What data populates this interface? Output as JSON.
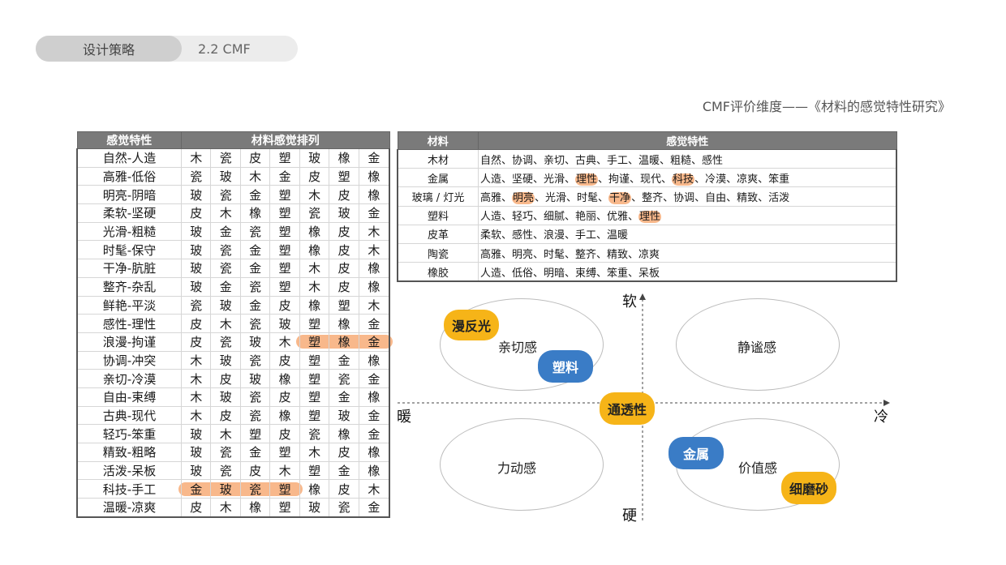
{
  "header": {
    "section": "设计策略",
    "subsection": "2.2 CMF"
  },
  "reference": "CMF评价维度——《材料的感觉特性研究》",
  "table1": {
    "headers": [
      "感觉特性",
      "材料感觉排列"
    ],
    "rows": [
      [
        "自然-人造",
        "木",
        "瓷",
        "皮",
        "塑",
        "玻",
        "橡",
        "金"
      ],
      [
        "高雅-低俗",
        "瓷",
        "玻",
        "木",
        "金",
        "皮",
        "塑",
        "橡"
      ],
      [
        "明亮-阴暗",
        "玻",
        "瓷",
        "金",
        "塑",
        "木",
        "皮",
        "橡"
      ],
      [
        "柔软-坚硬",
        "皮",
        "木",
        "橡",
        "塑",
        "瓷",
        "玻",
        "金"
      ],
      [
        "光滑-粗糙",
        "玻",
        "金",
        "瓷",
        "塑",
        "橡",
        "皮",
        "木"
      ],
      [
        "时髦-保守",
        "玻",
        "瓷",
        "金",
        "塑",
        "橡",
        "皮",
        "木"
      ],
      [
        "干净-肮脏",
        "玻",
        "瓷",
        "金",
        "塑",
        "木",
        "皮",
        "橡"
      ],
      [
        "整齐-杂乱",
        "玻",
        "金",
        "瓷",
        "塑",
        "木",
        "皮",
        "橡"
      ],
      [
        "鲜艳-平淡",
        "瓷",
        "玻",
        "金",
        "皮",
        "橡",
        "塑",
        "木"
      ],
      [
        "感性-理性",
        "皮",
        "木",
        "瓷",
        "玻",
        "塑",
        "橡",
        "金"
      ],
      [
        "浪漫-拘谨",
        "皮",
        "瓷",
        "玻",
        "木",
        "塑",
        "橡",
        "金"
      ],
      [
        "协调-冲突",
        "木",
        "玻",
        "瓷",
        "皮",
        "塑",
        "金",
        "橡"
      ],
      [
        "亲切-冷漠",
        "木",
        "皮",
        "玻",
        "橡",
        "塑",
        "瓷",
        "金"
      ],
      [
        "自由-束缚",
        "木",
        "玻",
        "瓷",
        "皮",
        "塑",
        "金",
        "橡"
      ],
      [
        "古典-现代",
        "木",
        "皮",
        "瓷",
        "橡",
        "塑",
        "玻",
        "金"
      ],
      [
        "轻巧-笨重",
        "玻",
        "木",
        "塑",
        "皮",
        "瓷",
        "橡",
        "金"
      ],
      [
        "精致-粗略",
        "玻",
        "瓷",
        "金",
        "塑",
        "木",
        "皮",
        "橡"
      ],
      [
        "活泼-呆板",
        "玻",
        "瓷",
        "皮",
        "木",
        "塑",
        "金",
        "橡"
      ],
      [
        "科技-手工",
        "金",
        "玻",
        "瓷",
        "塑",
        "橡",
        "皮",
        "木"
      ],
      [
        "温暖-凉爽",
        "皮",
        "木",
        "橡",
        "塑",
        "玻",
        "瓷",
        "金"
      ]
    ]
  },
  "table2": {
    "headers": [
      "材料",
      "感觉特性"
    ],
    "rows": [
      {
        "material": "木材",
        "parts": [
          [
            "自然、协调、亲切、古典、手工、温暖、粗糙、感性",
            false
          ]
        ]
      },
      {
        "material": "金属",
        "parts": [
          [
            "人造、坚硬、光滑、",
            false
          ],
          [
            "理性",
            true
          ],
          [
            "、拘谨、现代、",
            false
          ],
          [
            "科技",
            true
          ],
          [
            "、冷漠、凉爽、笨重",
            false
          ]
        ]
      },
      {
        "material": "玻璃 / 灯光",
        "parts": [
          [
            "高雅、",
            false
          ],
          [
            "明亮",
            true
          ],
          [
            "、光滑、时髦、",
            false
          ],
          [
            "干净",
            true
          ],
          [
            "、整齐、协调、自由、精致、活泼",
            false
          ]
        ]
      },
      {
        "material": "塑料",
        "parts": [
          [
            "人造、轻巧、细腻、艳丽、优雅、",
            false
          ],
          [
            "理性",
            true
          ]
        ]
      },
      {
        "material": "皮革",
        "parts": [
          [
            "柔软、感性、浪漫、手工、温暖",
            false
          ]
        ]
      },
      {
        "material": "陶瓷",
        "parts": [
          [
            "高雅、明亮、时髦、整齐、精致、凉爽",
            false
          ]
        ]
      },
      {
        "material": "橡胶",
        "parts": [
          [
            "人造、低俗、明暗、束缚、笨重、呆板",
            false
          ]
        ]
      }
    ]
  },
  "diagram": {
    "axis": {
      "top": "软",
      "bottom": "硬",
      "left": "暖",
      "right": "冷"
    },
    "quadrants": {
      "top_left": "亲切感",
      "top_right": "静谧感",
      "bottom_left": "力动感",
      "bottom_right": "价值感"
    },
    "tags": {
      "diffuse": "漫反光",
      "plastic": "塑料",
      "translucent": "通透性",
      "metal": "金属",
      "fine_sand": "细磨砂"
    },
    "colors": {
      "yellow": "#f6b418",
      "blue": "#3a7cc6",
      "highlight": "#f5a064"
    }
  }
}
